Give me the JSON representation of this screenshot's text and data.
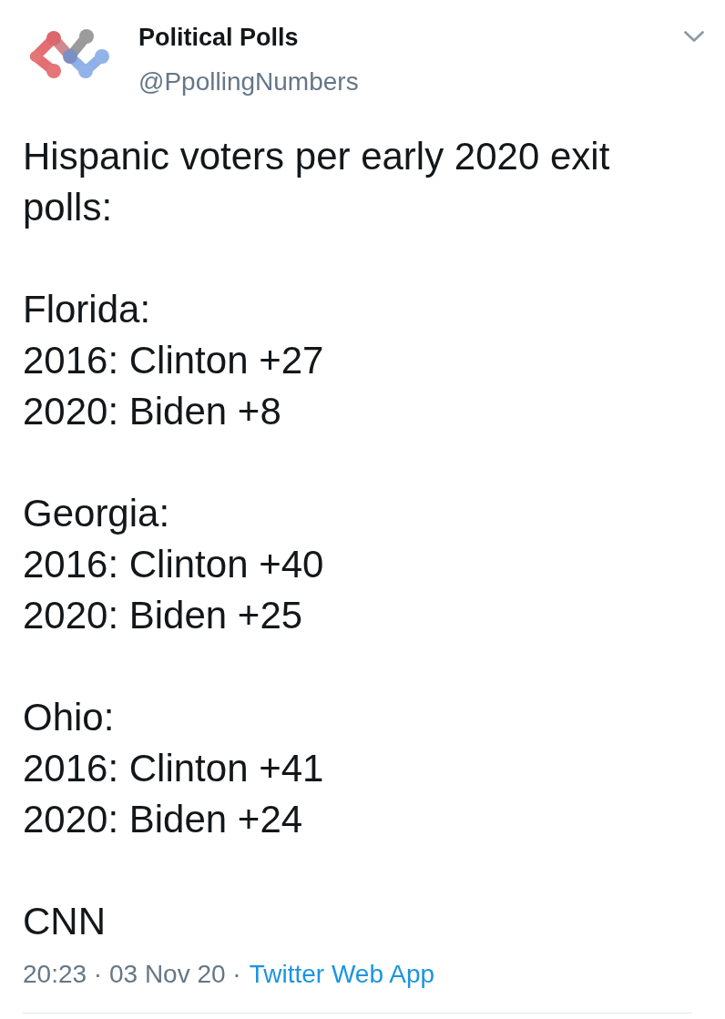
{
  "author": {
    "name": "Political Polls",
    "handle": "@PpollingNumbers"
  },
  "tweet": {
    "paragraphs": [
      "Hispanic voters per early 2020 exit polls:",
      "Florida:\n2016: Clinton +27\n2020: Biden +8",
      "Georgia:\n2016: Clinton +40\n2020: Biden +25",
      "Ohio:\n2016: Clinton +41\n2020: Biden +24",
      "CNN"
    ]
  },
  "meta": {
    "timestamp": "20:23 · 03 Nov 20 ·",
    "source": "Twitter Web App"
  }
}
